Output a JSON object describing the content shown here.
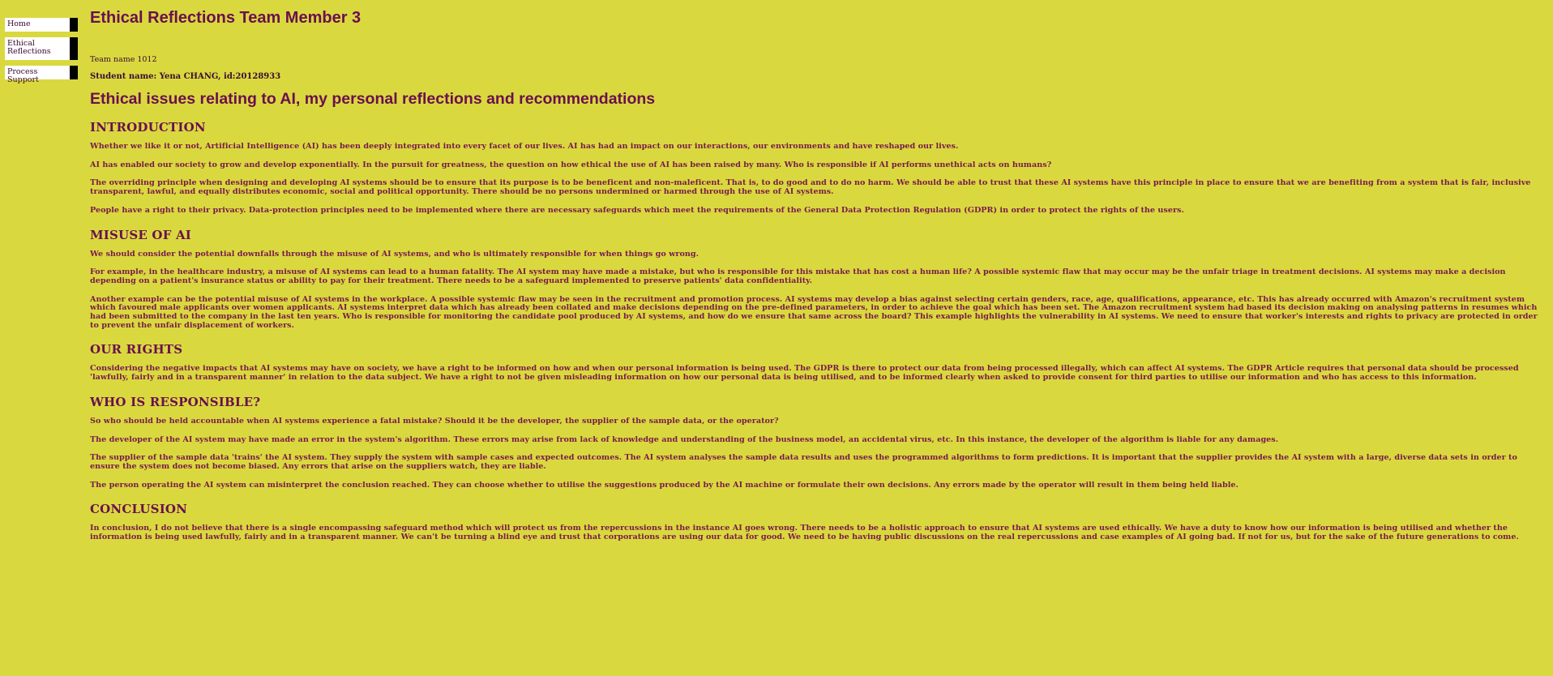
{
  "nav": {
    "items": [
      {
        "label": "Home"
      },
      {
        "label": "Ethical Reflections"
      },
      {
        "label": "Process Support"
      }
    ]
  },
  "page": {
    "title": "Ethical Reflections Team Member 3",
    "team": "Team name 1012",
    "student": "Student name: Yena CHANG, id:20128933",
    "subtitle": "Ethical issues relating to AI, my personal reflections and recommendations"
  },
  "sections": [
    {
      "heading": "INTRODUCTION",
      "paragraphs": [
        "Whether we like it or not, Artificial Intelligence (AI) has been deeply integrated into every facet of our lives. AI has had an impact on our interactions, our environments and have reshaped our lives.",
        "AI has enabled our society to grow and develop exponentially. In the pursuit for greatness, the question on how ethical the use of AI has been raised by many. Who is responsible if AI performs unethical acts on humans?",
        "The overriding principle when designing and developing AI systems should be to ensure that its purpose is to be beneficent and non-maleficent. That is, to do good and to do no harm. We should be able to trust that these AI systems have this principle in place to ensure that we are benefiting from a system that is fair, inclusive transparent, lawful, and equally distributes economic, social and political opportunity. There should be no persons undermined or harmed through the use of AI systems.",
        "People have a right to their privacy. Data-protection principles need to be implemented where there are necessary safeguards which meet the requirements of the General Data Protection Regulation (GDPR) in order to protect the rights of the users."
      ]
    },
    {
      "heading": "MISUSE OF AI",
      "paragraphs": [
        "We should consider the potential downfalls through the misuse of AI systems, and who is ultimately responsible for when things go wrong.",
        "For example, in the healthcare industry, a misuse of AI systems can lead to a human fatality. The AI system may have made a mistake, but who is responsible for this mistake that has cost a human life? A possible systemic flaw that may occur may be the unfair triage in treatment decisions. AI systems may make a decision depending on a patient's insurance status or ability to pay for their treatment. There needs to be a safeguard implemented to preserve patients' data confidentiality.",
        "Another example can be the potential misuse of AI systems in the workplace. A possible systemic flaw may be seen in the recruitment and promotion process. AI systems may develop a bias against selecting certain genders, race, age, qualifications, appearance, etc. This has already occurred with Amazon's recruitment system which favoured male applicants over women applicants. AI systems interpret data which has already been collated and make decisions depending on the pre-defined parameters, in order to achieve the goal which has been set. The Amazon recruitment system had based its decision making on analysing patterns in resumes which had been submitted to the company in the last ten years. Who is responsible for monitoring the candidate pool produced by AI systems, and how do we ensure that same across the board? This example highlights the vulnerability in AI systems. We need to ensure that worker's interests and rights to privacy are protected in order to prevent the unfair displacement of workers."
      ]
    },
    {
      "heading": "OUR RIGHTS",
      "paragraphs": [
        "Considering the negative impacts that AI systems may have on society, we have a right to be informed on how and when our personal information is being used. The GDPR is there to protect our data from being processed illegally, which can affect AI systems. The GDPR Article requires that personal data should be processed 'lawfully, fairly and in a transparent manner' in relation to the data subject. We have a right to not be given misleading information on how our personal data is being utilised, and to be informed clearly when asked to provide consent for third parties to utilise our information and who has access to this information."
      ]
    },
    {
      "heading": "WHO IS RESPONSIBLE?",
      "paragraphs": [
        "So who should be held accountable when AI systems experience a fatal mistake? Should it be the developer, the supplier of the sample data, or the operator?",
        "The developer of the AI system may have made an error in the system's algorithm. These errors may arise from lack of knowledge and understanding of the business model, an accidental virus, etc. In this instance, the developer of the algorithm is liable for any damages.",
        "The supplier of the sample data 'trains' the AI system. They supply the system with sample cases and expected outcomes. The AI system analyses the sample data results and uses the programmed algorithms to form predictions. It is important that the supplier provides the AI system with a large, diverse data sets in order to ensure the system does not become biased. Any errors that arise on the suppliers watch, they are liable.",
        "The person operating the AI system can misinterpret the conclusion reached. They can choose whether to utilise the suggestions produced by the AI machine or formulate their own decisions. Any errors made by the operator will result in them being held liable."
      ]
    },
    {
      "heading": "CONCLUSION",
      "paragraphs": [
        "In conclusion, I do not believe that there is a single encompassing safeguard method which will protect us from the repercussions in the instance AI goes wrong. There needs to be a holistic approach to ensure that AI systems are used ethically. We have a duty to know how our information is being utilised and whether the information is being used lawfully, fairly and in a transparent manner. We can't be turning a blind eye and trust that corporations are using our data for good. We need to be having public discussions on the real repercussions and case examples of AI going bad. If not for us, but for the sake of the future generations to come."
      ]
    }
  ],
  "colors": {
    "background": "#d9d93f",
    "heading": "#6b0f4f",
    "text": "#7a1a4a",
    "nav_background": "#ffffff",
    "nav_border": "#000000"
  }
}
